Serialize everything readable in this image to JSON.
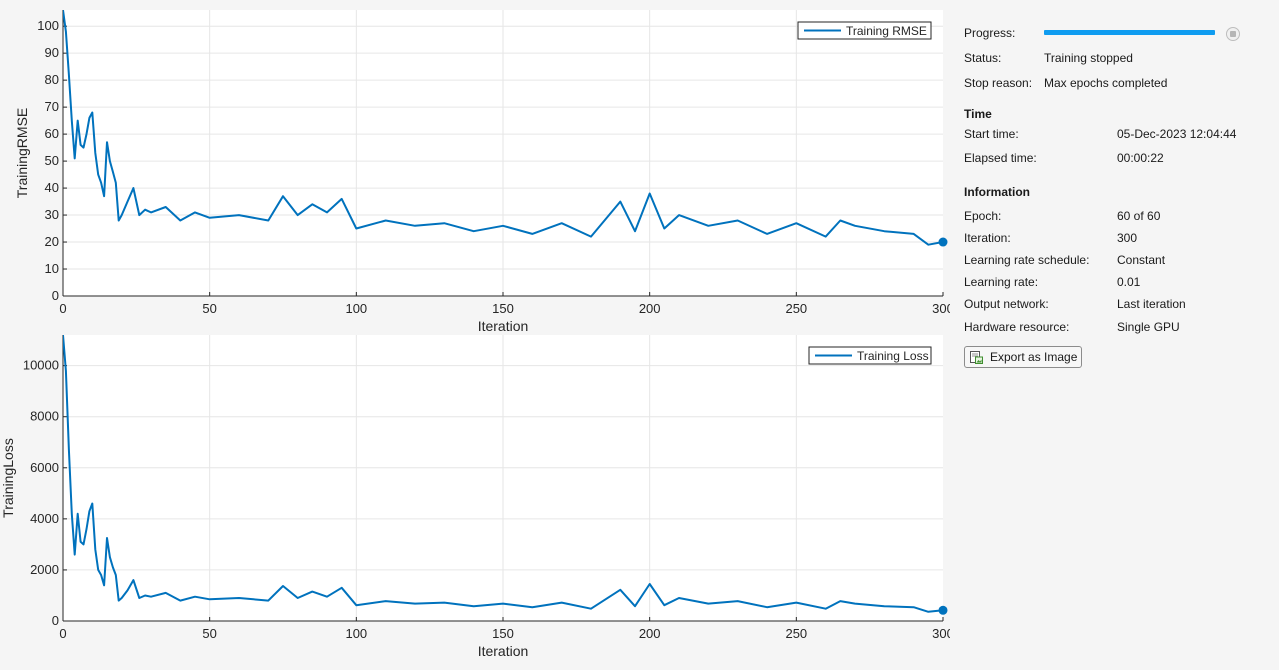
{
  "charts": {
    "rmse": {
      "ylabel": "TrainingRMSE",
      "xlabel": "Iteration",
      "legend": "Training RMSE",
      "yticks": [
        "0",
        "10",
        "20",
        "30",
        "40",
        "50",
        "60",
        "70",
        "80",
        "90",
        "100"
      ],
      "xticks": [
        "0",
        "50",
        "100",
        "150",
        "200",
        "250",
        "300"
      ]
    },
    "loss": {
      "ylabel": "TrainingLoss",
      "xlabel": "Iteration",
      "legend": "Training Loss",
      "yticks": [
        "0",
        "2000",
        "4000",
        "6000",
        "8000",
        "10000"
      ],
      "xticks": [
        "0",
        "50",
        "100",
        "150",
        "200",
        "250",
        "300"
      ]
    }
  },
  "chart_data": [
    {
      "type": "line",
      "xlabel": "Iteration",
      "ylabel": "TrainingRMSE",
      "xlim": [
        0,
        300
      ],
      "ylim": [
        0,
        106
      ],
      "grid": true,
      "legend_position": "top-right",
      "series": [
        {
          "name": "Training RMSE",
          "color": "#0072bd",
          "marker_at_end": true,
          "x": [
            0,
            1,
            2,
            3,
            4,
            5,
            6,
            7,
            8,
            9,
            10,
            11,
            12,
            13,
            14,
            15,
            16,
            17,
            18,
            19,
            20,
            22,
            24,
            26,
            28,
            30,
            35,
            40,
            45,
            50,
            60,
            70,
            75,
            80,
            85,
            90,
            95,
            100,
            110,
            120,
            130,
            140,
            150,
            160,
            170,
            180,
            190,
            195,
            200,
            205,
            210,
            220,
            230,
            240,
            250,
            260,
            265,
            270,
            280,
            290,
            295,
            300
          ],
          "y": [
            106,
            98,
            82,
            65,
            51,
            65,
            56,
            55,
            60,
            66,
            68,
            53,
            45,
            42,
            37,
            57,
            50,
            46,
            42,
            28,
            30,
            35,
            40,
            30,
            32,
            31,
            33,
            28,
            31,
            29,
            30,
            28,
            37,
            30,
            34,
            31,
            36,
            25,
            28,
            26,
            27,
            24,
            26,
            23,
            27,
            22,
            35,
            24,
            38,
            25,
            30,
            26,
            28,
            23,
            27,
            22,
            28,
            26,
            24,
            23,
            19,
            20
          ]
        }
      ]
    },
    {
      "type": "line",
      "xlabel": "Iteration",
      "ylabel": "TrainingLoss",
      "xlim": [
        0,
        300
      ],
      "ylim": [
        0,
        11200
      ],
      "grid": true,
      "legend_position": "top-right",
      "series": [
        {
          "name": "Training Loss",
          "color": "#0072bd",
          "marker_at_end": true,
          "x": [
            0,
            1,
            2,
            3,
            4,
            5,
            6,
            7,
            8,
            9,
            10,
            11,
            12,
            13,
            14,
            15,
            16,
            17,
            18,
            19,
            20,
            22,
            24,
            26,
            28,
            30,
            35,
            40,
            45,
            50,
            60,
            70,
            75,
            80,
            85,
            90,
            95,
            100,
            110,
            120,
            130,
            140,
            150,
            160,
            170,
            180,
            190,
            195,
            200,
            205,
            210,
            220,
            230,
            240,
            250,
            260,
            265,
            270,
            280,
            290,
            295,
            300
          ],
          "y": [
            11200,
            9800,
            6700,
            4200,
            2600,
            4200,
            3100,
            3000,
            3600,
            4300,
            4600,
            2800,
            2000,
            1800,
            1400,
            3250,
            2500,
            2100,
            1800,
            800,
            900,
            1200,
            1600,
            900,
            1000,
            950,
            1100,
            800,
            950,
            850,
            900,
            800,
            1370,
            900,
            1150,
            950,
            1300,
            620,
            780,
            680,
            720,
            580,
            680,
            540,
            720,
            480,
            1220,
            580,
            1450,
            620,
            900,
            680,
            780,
            540,
            720,
            480,
            780,
            680,
            580,
            540,
            360,
            420
          ]
        }
      ]
    }
  ],
  "panel": {
    "progress_label": "Progress:",
    "progress_fraction": 1.0,
    "status_label": "Status:",
    "status_value": "Training stopped",
    "stop_reason_label": "Stop reason:",
    "stop_reason_value": "Max epochs completed",
    "time_title": "Time",
    "start_time_label": "Start time:",
    "start_time_value": "05-Dec-2023 12:04:44",
    "elapsed_label": "Elapsed time:",
    "elapsed_value": "00:00:22",
    "info_title": "Information",
    "epoch_label": "Epoch:",
    "epoch_value": "60 of 60",
    "iteration_label": "Iteration:",
    "iteration_value": "300",
    "lr_schedule_label": "Learning rate schedule:",
    "lr_schedule_value": "Constant",
    "lr_label": "Learning rate:",
    "lr_value": "0.01",
    "output_label": "Output network:",
    "output_value": "Last iteration",
    "hw_label": "Hardware resource:",
    "hw_value": "Single GPU",
    "export_label": "Export as Image",
    "accent_color": "#0f9cf0"
  }
}
